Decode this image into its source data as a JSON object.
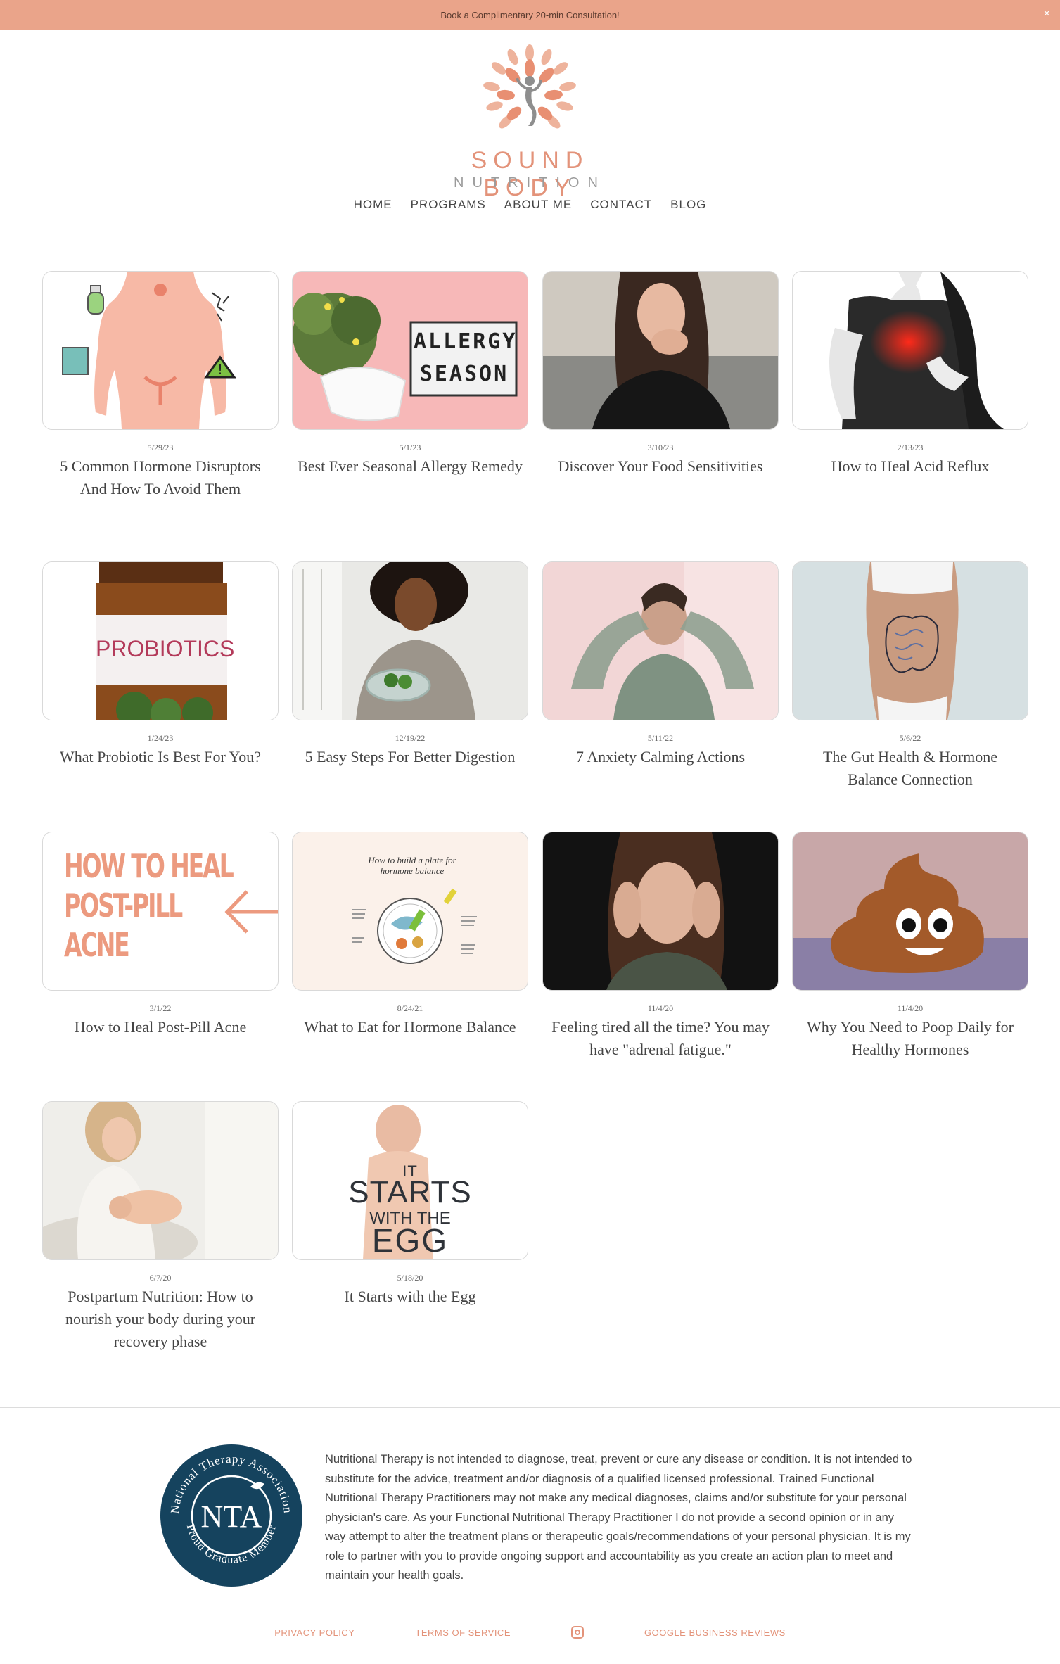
{
  "banner": {
    "text": "Book a Complimentary 20-min Consultation!",
    "close": "×"
  },
  "brand": {
    "name": "SOUND BODY",
    "sub": "NUTRITION",
    "accent": "#e3937a"
  },
  "nav": [
    "HOME",
    "PROGRAMS",
    "ABOUT ME",
    "CONTACT",
    "BLOG"
  ],
  "posts": [
    {
      "date": "5/29/23",
      "title": "5 Common Hormone Disruptors And How To Avoid Them"
    },
    {
      "date": "5/1/23",
      "title": "Best Ever Seasonal Allergy Remedy"
    },
    {
      "date": "3/10/23",
      "title": "Discover Your Food Sensitivities"
    },
    {
      "date": "2/13/23",
      "title": "How to Heal Acid Reflux"
    },
    {
      "date": "1/24/23",
      "title": "What Probiotic Is Best For You?"
    },
    {
      "date": "12/19/22",
      "title": "5 Easy Steps For Better Digestion"
    },
    {
      "date": "5/11/22",
      "title": "7 Anxiety Calming Actions"
    },
    {
      "date": "5/6/22",
      "title": "The Gut Health & Hormone Balance Connection"
    },
    {
      "date": "3/1/22",
      "title": "How to Heal Post-Pill Acne"
    },
    {
      "date": "8/24/21",
      "title": "What to Eat for Hormone Balance"
    },
    {
      "date": "11/4/20",
      "title": "Feeling tired all the time? You may have \"adrenal fatigue.\""
    },
    {
      "date": "11/4/20",
      "title": "Why You Need to Poop Daily for Healthy Hormones"
    },
    {
      "date": "6/7/20",
      "title": "Postpartum Nutrition: How to nourish your body during your recovery phase"
    },
    {
      "date": "5/18/20",
      "title": "It Starts with the Egg"
    }
  ],
  "thumb_text": {
    "allergy_1": "ALLERGY",
    "allergy_2": "SEASON",
    "probiotics": "PROBIOTICS",
    "acne": [
      "HOW TO HEAL",
      "POST-PILL",
      "ACNE"
    ],
    "plate_title": "How to build a plate for hormone balance",
    "egg": [
      "IT",
      "STARTS",
      "WITH THE",
      "EGG"
    ]
  },
  "footer": {
    "nta_ring_top": "National Therapy Association",
    "nta_ring_bottom": "Proud Graduate Member",
    "nta_center": "NTA",
    "disclaimer": "Nutritional Therapy is not intended to diagnose, treat, prevent or cure any disease or condition. It is not intended to substitute for the advice, treatment and/or diagnosis of a qualified licensed professional. Trained Functional Nutritional Therapy Practitioners may not make any medical diagnoses, claims and/or substitute for your personal physician's care. As your Functional Nutritional Therapy Practitioner I do not provide a second opinion or in any way attempt to alter the treatment plans or therapeutic goals/recommendations of your personal physician. It is my role to partner with you to provide ongoing support and accountability as you create an action plan to meet and maintain your health goals.",
    "links": [
      "PRIVACY POLICY",
      "TERMS OF SERVICE",
      "GOOGLE BUSINESS REVIEWS"
    ],
    "instagram_icon": "instagram-icon"
  }
}
